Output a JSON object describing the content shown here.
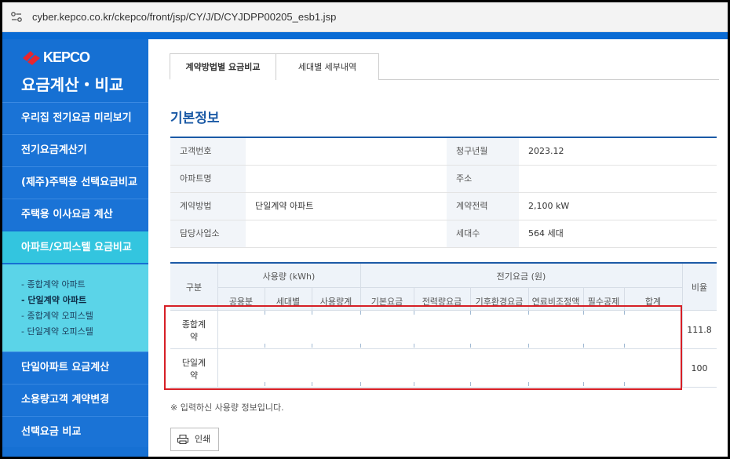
{
  "browser": {
    "url": "cyber.kepco.co.kr/ckepco/front/jsp/CY/J/D/CYJDPP00205_esb1.jsp"
  },
  "sidebar": {
    "logo": "KEPCO",
    "title": "요금계산・비교",
    "items": [
      {
        "label": "우리집 전기요금 미리보기"
      },
      {
        "label": "전기요금계산기"
      },
      {
        "label": "(제주)주택용 선택요금비교"
      },
      {
        "label": "주택용 이사요금 계산"
      },
      {
        "label": "아파트/오피스텔 요금비교"
      }
    ],
    "sub_items": [
      {
        "label": "- 종합계약 아파트"
      },
      {
        "label": "- 단일계약 아파트"
      },
      {
        "label": "- 종합계약 오피스텔"
      },
      {
        "label": "- 단일계약 오피스텔"
      }
    ],
    "items_bottom": [
      {
        "label": "단일아파트 요금계산"
      },
      {
        "label": "소용량고객 계약변경"
      },
      {
        "label": "선택요금 비교"
      }
    ]
  },
  "tabs": [
    {
      "label": "계약방법별 요금비교"
    },
    {
      "label": "세대별 세부내역"
    }
  ],
  "section_title": "기본정보",
  "info": {
    "customer_no_label": "고객번호",
    "customer_no": "",
    "billing_month_label": "청구년월",
    "billing_month": "2023.12",
    "apt_name_label": "아파트명",
    "apt_name": "",
    "address_label": "주소",
    "address": "",
    "contract_method_label": "계약방법",
    "contract_method": "단일계약 아파트",
    "contract_power_label": "계약전력",
    "contract_power": "2,100 kW",
    "office_label": "담당사업소",
    "office": "",
    "households_label": "세대수",
    "households": "564 세대"
  },
  "compare": {
    "col_category": "구분",
    "group_usage": "사용량 (kWh)",
    "group_charge": "전기요금 (원)",
    "col_ratio": "비율",
    "usage_cols": [
      "공용분",
      "세대별",
      "사용량계"
    ],
    "charge_cols": [
      "기본요금",
      "전력량요금",
      "기후환경요금",
      "연료비조정액",
      "필수공제",
      "합계"
    ],
    "rows": [
      {
        "label_1": "종합계",
        "label_2": "약",
        "ratio": "111.8"
      },
      {
        "label_1": "단일계",
        "label_2": "약",
        "ratio": "100"
      }
    ]
  },
  "note": "※ 입력하신 사용량 정보입니다.",
  "print_label": "인쇄",
  "colors": {
    "brand_blue": "#1670d3",
    "active_cyan": "#33c5df",
    "highlight_red": "#d61f26"
  }
}
